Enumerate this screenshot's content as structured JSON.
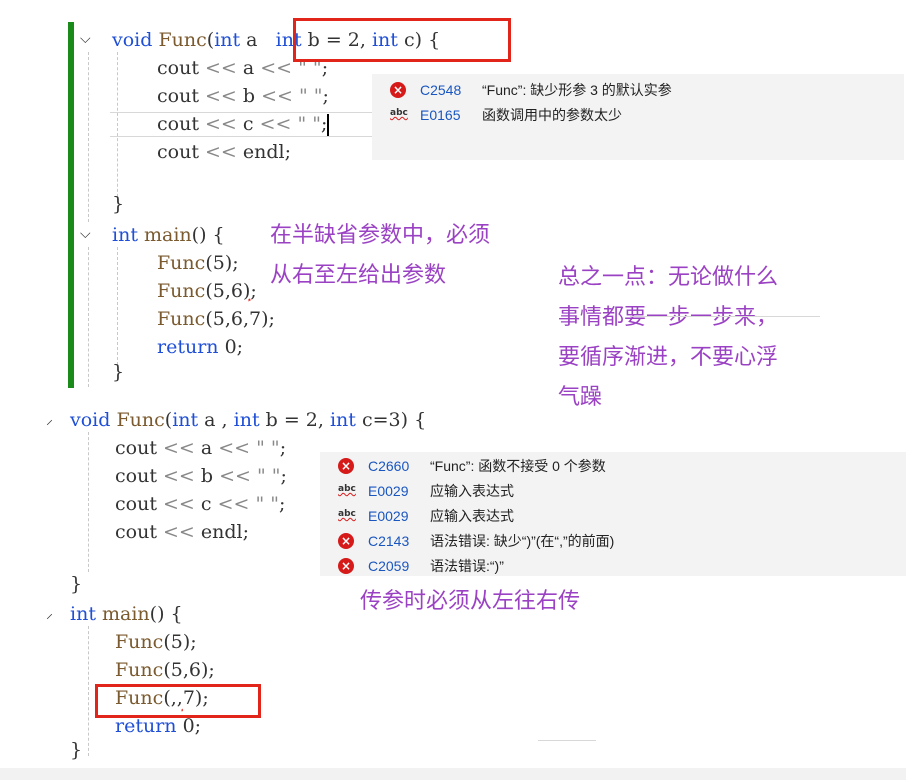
{
  "top_code": {
    "lines": [
      {
        "parts": [
          [
            "kw",
            "void "
          ],
          [
            "fn",
            "Func"
          ],
          [
            "",
            "("
          ],
          [
            "kw",
            "int"
          ],
          [
            "",
            " a "
          ]
        ]
      },
      {
        "parts": [
          [
            "",
            "cout "
          ],
          [
            "cmt",
            "<<"
          ],
          [
            "",
            " a "
          ],
          [
            "cmt",
            "<<"
          ],
          [
            "",
            " "
          ],
          [
            "cmt",
            "\" \""
          ],
          [
            "",
            ";"
          ]
        ]
      },
      {
        "parts": [
          [
            "",
            "cout "
          ],
          [
            "cmt",
            "<<"
          ],
          [
            "",
            " b "
          ],
          [
            "cmt",
            "<<"
          ],
          [
            "",
            " "
          ],
          [
            "cmt",
            "\" \""
          ],
          [
            "",
            ";"
          ]
        ]
      },
      {
        "parts": [
          [
            "",
            "cout "
          ],
          [
            "cmt",
            "<<"
          ],
          [
            "",
            " c "
          ],
          [
            "cmt",
            "<<"
          ],
          [
            "",
            " "
          ],
          [
            "cmt",
            "\" \""
          ],
          [
            "",
            ";"
          ]
        ]
      },
      {
        "parts": [
          [
            "",
            "cout "
          ],
          [
            "cmt",
            "<<"
          ],
          [
            "",
            " endl;"
          ]
        ]
      },
      {
        "parts": [
          [
            "",
            "}"
          ]
        ]
      },
      {
        "parts": [
          [
            "kw",
            "int "
          ],
          [
            "fn",
            "main"
          ],
          [
            "",
            "() {"
          ]
        ]
      },
      {
        "parts": [
          [
            "fn",
            "Func"
          ],
          [
            "",
            "(5);"
          ]
        ]
      },
      {
        "parts": [
          [
            "fn",
            "Func"
          ],
          [
            "",
            "(5,6"
          ],
          [
            "squig",
            ")"
          ],
          [
            "",
            ";"
          ]
        ]
      },
      {
        "parts": [
          [
            "fn",
            "Func"
          ],
          [
            "",
            "(5,6,7);"
          ]
        ]
      },
      {
        "parts": [
          [
            "kw",
            "return "
          ],
          [
            "",
            "0;"
          ]
        ]
      },
      {
        "parts": [
          [
            "",
            "}"
          ]
        ]
      }
    ],
    "highlight_params": [
      [
        "kw",
        "int"
      ],
      [
        "",
        " b = 2, "
      ],
      [
        "kw",
        "int"
      ],
      [
        "",
        " c"
      ]
    ],
    "after_highlight": ") {"
  },
  "top_tooltip": {
    "rows": [
      {
        "icon": "error",
        "code": "C2548",
        "text": "“Func”: 缺少形参 3 的默认实参"
      },
      {
        "icon": "abc",
        "code": "E0165",
        "text": "函数调用中的参数太少"
      }
    ]
  },
  "bottom_code": {
    "lines": [
      {
        "parts": [
          [
            "kw",
            "void "
          ],
          [
            "fn",
            "Func"
          ],
          [
            "",
            "("
          ],
          [
            "kw",
            "int"
          ],
          [
            "",
            " a , "
          ],
          [
            "kw",
            "int"
          ],
          [
            "",
            " b = 2, "
          ],
          [
            "kw",
            "int"
          ],
          [
            "",
            " c=3) {"
          ]
        ]
      },
      {
        "parts": [
          [
            "",
            "cout "
          ],
          [
            "cmt",
            "<<"
          ],
          [
            "",
            " a "
          ],
          [
            "cmt",
            "<<"
          ],
          [
            "",
            " "
          ],
          [
            "cmt",
            "\" \""
          ],
          [
            "",
            ";"
          ]
        ]
      },
      {
        "parts": [
          [
            "",
            "cout "
          ],
          [
            "cmt",
            "<<"
          ],
          [
            "",
            " b "
          ],
          [
            "cmt",
            "<<"
          ],
          [
            "",
            " "
          ],
          [
            "cmt",
            "\" \""
          ],
          [
            "",
            ";"
          ]
        ]
      },
      {
        "parts": [
          [
            "",
            "cout "
          ],
          [
            "cmt",
            "<<"
          ],
          [
            "",
            " c "
          ],
          [
            "cmt",
            "<<"
          ],
          [
            "",
            " "
          ],
          [
            "cmt",
            "\" \""
          ],
          [
            "",
            ";"
          ]
        ]
      },
      {
        "parts": [
          [
            "",
            "cout "
          ],
          [
            "cmt",
            "<<"
          ],
          [
            "",
            " endl;"
          ]
        ]
      },
      {
        "parts": [
          [
            "",
            "}"
          ]
        ]
      },
      {
        "parts": [
          [
            "kw",
            "int "
          ],
          [
            "fn",
            "main"
          ],
          [
            "",
            "() {"
          ]
        ]
      },
      {
        "parts": [
          [
            "fn",
            "Func"
          ],
          [
            "",
            "(5);"
          ]
        ]
      },
      {
        "parts": [
          [
            "fn",
            "Func"
          ],
          [
            "",
            "(5,6);"
          ]
        ]
      },
      {
        "parts": [
          [
            "fn",
            "Func"
          ],
          [
            "",
            "("
          ],
          [
            "squig",
            ",,"
          ],
          [
            "",
            "7);"
          ]
        ]
      },
      {
        "parts": [
          [
            "kw",
            "return "
          ],
          [
            "",
            "0;"
          ]
        ]
      },
      {
        "parts": [
          [
            "",
            "}"
          ]
        ]
      }
    ]
  },
  "bottom_tooltip": {
    "rows": [
      {
        "icon": "error",
        "code": "C2660",
        "text": "“Func”: 函数不接受 0 个参数"
      },
      {
        "icon": "abc",
        "code": "E0029",
        "text": "应输入表达式"
      },
      {
        "icon": "abc",
        "code": "E0029",
        "text": "应输入表达式"
      },
      {
        "icon": "error",
        "code": "C2143",
        "text": "语法错误: 缺少“)”(在“,”的前面)"
      },
      {
        "icon": "error",
        "code": "C2059",
        "text": "语法错误:“)”"
      }
    ]
  },
  "annotations": {
    "a1_line1": "在半缺省参数中，必须",
    "a1_line2": "从右至左给出参数",
    "a2_line1": "总之一点：无论做什么",
    "a2_line2": "事情都要一步一步来，",
    "a2_line3": "要循序渐进，不要心浮",
    "a2_line4": "气躁",
    "a3": "传参时必须从左往右传"
  },
  "colors": {
    "keyword": "#1f4fd6",
    "annotation": "#9b42c4",
    "error": "#d61a1a",
    "highlight_box": "#e1251b",
    "change_bar": "#1a8a1a"
  }
}
